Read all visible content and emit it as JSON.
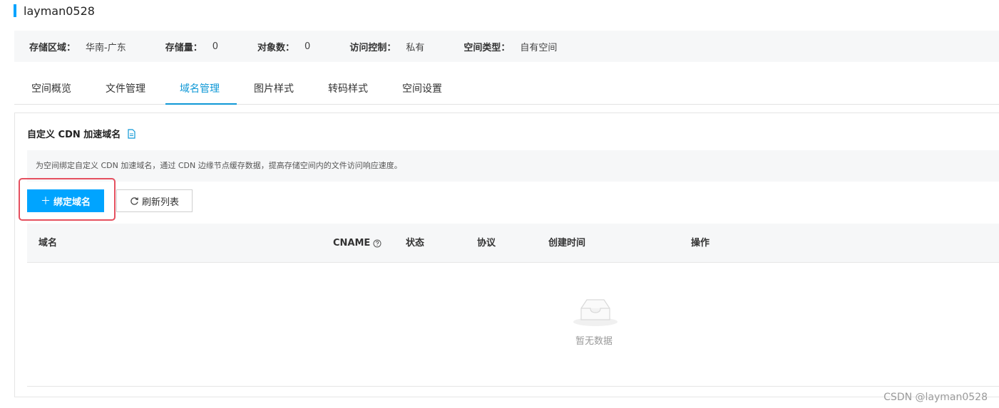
{
  "bucket": {
    "name": "layman0528"
  },
  "info": {
    "items": [
      {
        "label": "存储区域：",
        "value": "华南-广东"
      },
      {
        "label": "存储量：",
        "value": "0"
      },
      {
        "label": "对象数：",
        "value": "0"
      },
      {
        "label": "访问控制：",
        "value": "私有"
      },
      {
        "label": "空间类型：",
        "value": "自有空间"
      }
    ]
  },
  "tabs": [
    {
      "label": "空间概览"
    },
    {
      "label": "文件管理"
    },
    {
      "label": "域名管理",
      "active": true
    },
    {
      "label": "图片样式"
    },
    {
      "label": "转码样式"
    },
    {
      "label": "空间设置"
    }
  ],
  "panel": {
    "title": "自定义 CDN 加速域名",
    "notice": "为空间绑定自定义 CDN 加速域名，通过 CDN 边缘节点缓存数据，提高存储空间内的文件访问响应速度。",
    "bind_button": "绑定域名",
    "bind_icon": "plus-icon",
    "refresh_button": "刷新列表",
    "refresh_icon": "refresh-icon",
    "doc_icon": "document-icon",
    "highlight_color": "#e5505f"
  },
  "table": {
    "headers": [
      "域名",
      "CNAME",
      "状态",
      "协议",
      "创建时间",
      "操作"
    ],
    "cname_help_icon": "question-circle-icon",
    "empty_text": "暂无数据",
    "empty_icon": "empty-inbox-icon"
  },
  "watermark": "CSDN @layman0528",
  "colors": {
    "accent": "#00a4ff",
    "tab_active": "#0f98d6",
    "bg_gray": "#f6f7f8"
  }
}
